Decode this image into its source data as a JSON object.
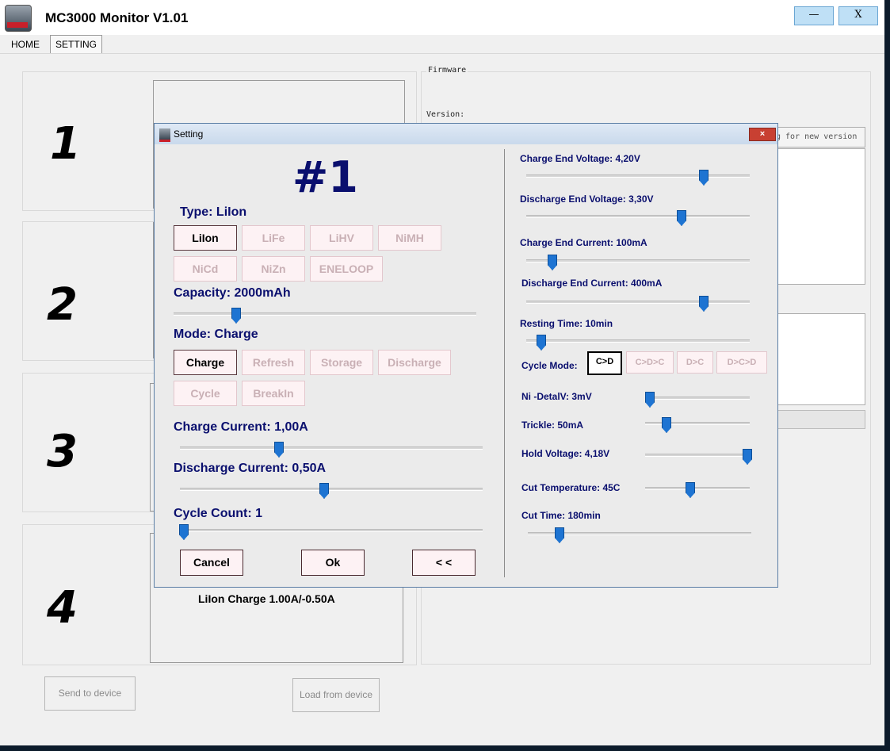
{
  "window": {
    "title": "MC3000 Monitor V1.01",
    "min_label": "—",
    "close_label": "X"
  },
  "tabs": [
    {
      "label": "HOME"
    },
    {
      "label": "SETTING"
    }
  ],
  "slots": [
    {
      "number": "1"
    },
    {
      "number": "2"
    },
    {
      "number": "3"
    },
    {
      "number": "4"
    }
  ],
  "slot4_summary": "LiIon  Charge  1.00A/-0.50A",
  "firmware": {
    "legend": "Firmware",
    "version_label": "Version:",
    "check_label": "g for new version"
  },
  "bottom": {
    "send": "Send to device",
    "load": "Load from device"
  },
  "dialog": {
    "title": "Setting",
    "close": "×",
    "heading": "#1",
    "type_label": "Type:  LiIon",
    "types": [
      "LiIon",
      "LiFe",
      "LiHV",
      "NiMH",
      "NiCd",
      "NiZn",
      "ENELOOP"
    ],
    "selected_type": "LiIon",
    "capacity_label": "Capacity:  2000mAh",
    "mode_label": "Mode:  Charge",
    "modes": [
      "Charge",
      "Refresh",
      "Storage",
      "Discharge",
      "Cycle",
      "BreakIn"
    ],
    "selected_mode": "Charge",
    "charge_current_label": "Charge Current:  1,00A",
    "discharge_current_label": "Discharge Current:  0,50A",
    "cycle_count_label": "Cycle Count:  1",
    "buttons": {
      "cancel": "Cancel",
      "ok": "Ok",
      "back": "< <"
    },
    "right": {
      "charge_end_voltage": "Charge End Voltage:  4,20V",
      "discharge_end_voltage": "Discharge End Voltage:  3,30V",
      "charge_end_current": "Charge End Current:  100mA",
      "discharge_end_current": "Discharge End Current:  400mA",
      "resting_time": "Resting Time:  10min",
      "cycle_mode_label": "Cycle Mode:",
      "cycle_modes": [
        "C>D",
        "C>D>C",
        "D>C",
        "D>C>D"
      ],
      "selected_cycle_mode": "C>D",
      "ni_delta_v": "Ni -DetalV:  3mV",
      "trickle": "Trickle:  50mA",
      "hold_voltage": "Hold Voltage:  4,18V",
      "cut_temperature": "Cut Temperature:  45C",
      "cut_time": "Cut Time:  180min"
    }
  },
  "colors": {
    "label_navy": "#0a0f6e",
    "slider_thumb": "#1e74d2",
    "chip_disabled_text": "#c9b0b5",
    "chip_bg": "#fdf2f4"
  }
}
